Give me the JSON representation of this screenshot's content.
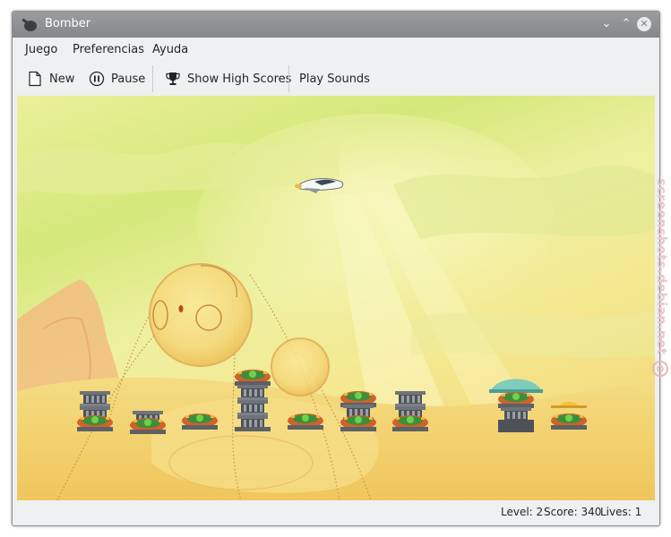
{
  "window": {
    "title": "Bomber"
  },
  "menubar": {
    "items": [
      "Juego",
      "Preferencias",
      "Ayuda"
    ]
  },
  "toolbar": {
    "new_label": "New",
    "pause_label": "Pause",
    "highscores_label": "Show High Scores",
    "sounds_label": "Play Sounds"
  },
  "status": {
    "level": "Level: 2",
    "score": "Score: 340",
    "lives": "Lives: 1"
  },
  "watermark": "screenshots.debian.net",
  "game": {
    "buildings": [
      {
        "floors": 3
      },
      {
        "floors": 1
      },
      {
        "floors": 1
      },
      {
        "floors": 5
      },
      {
        "floors": 1
      },
      {
        "floors": 3
      },
      {
        "floors": 3
      },
      {
        "floors": 4
      },
      {
        "floors": 2
      }
    ]
  },
  "colors": {
    "titlebar": "#8e9092",
    "toolbar_bg": "#eff0f1",
    "sky_green": "#d4e87a",
    "sky_yellow": "#f3d070"
  }
}
